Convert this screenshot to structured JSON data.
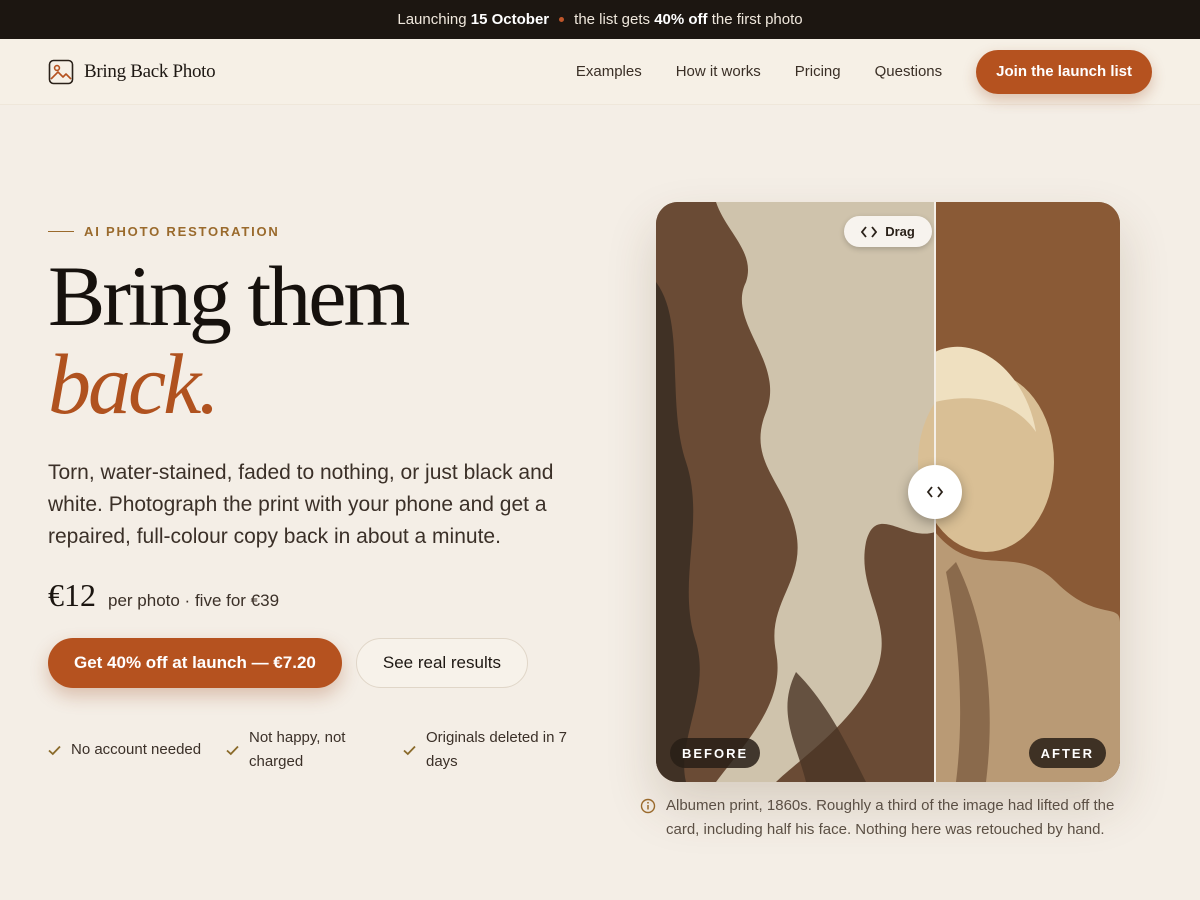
{
  "announcement": {
    "prefix": "Launching",
    "date": "15 October",
    "middle": "the list gets",
    "discount": "40% off",
    "suffix": "the first photo"
  },
  "nav": {
    "brand": "Bring Back Photo",
    "links": [
      "Examples",
      "How it works",
      "Pricing",
      "Questions"
    ],
    "cta": "Join the launch list"
  },
  "hero": {
    "eyebrow": "AI PHOTO RESTORATION",
    "title_line1": "Bring them",
    "title_line2": "back.",
    "lead": "Torn, water-stained, faded to nothing, or just black and white. Photograph the print with your phone and get a repaired, full-colour copy back in about a minute.",
    "price": "€12",
    "price_note": "per photo · five for €39",
    "primary_cta": "Get 40% off at launch — €7.20",
    "secondary_cta": "See real results",
    "checks": [
      "No account needed",
      "Not happy, not charged",
      "Originals deleted in 7 days"
    ]
  },
  "compare": {
    "drag_label": "Drag",
    "before_label": "BEFORE",
    "after_label": "AFTER",
    "caption": "Albumen print, 1860s. Roughly a third of the image had lifted off the card, including half his face. Nothing here was retouched by hand."
  },
  "colors": {
    "accent": "#b5521f",
    "topbar": "#1c1611",
    "background": "#f4eee6",
    "eyebrow": "#9a6a2c"
  },
  "icons": {
    "brand": "image-icon",
    "check": "check-icon",
    "drag": "code-arrows-icon",
    "info": "info-icon"
  }
}
